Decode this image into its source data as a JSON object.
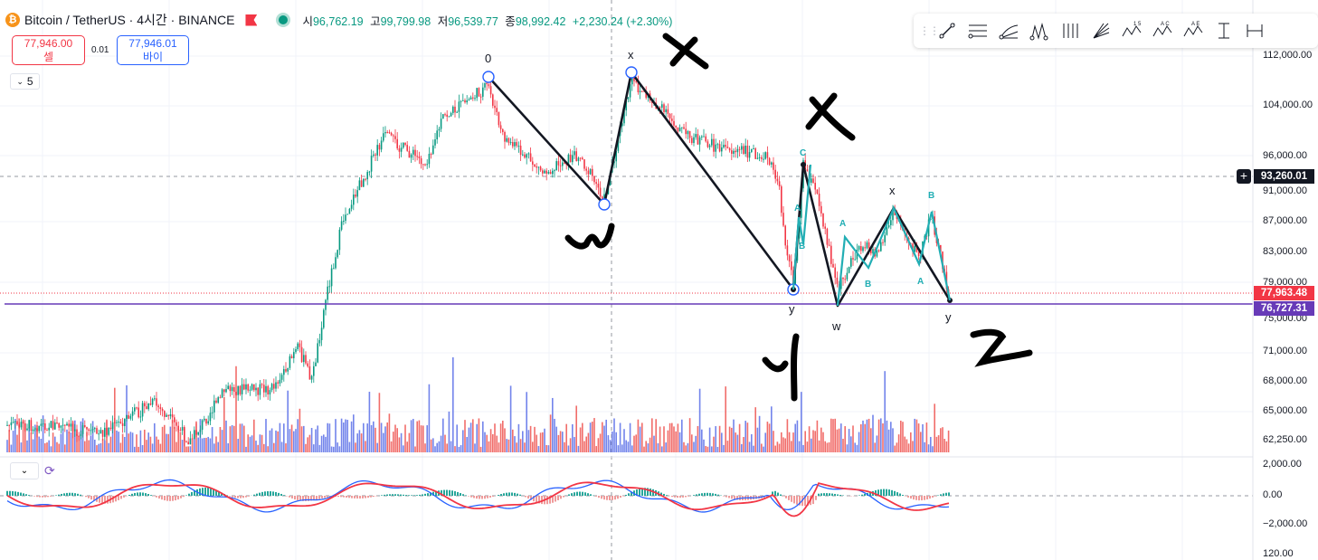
{
  "header": {
    "title": "Bitcoin / TetherUS · 4시간 · BINANCE",
    "ohlc": {
      "open_label": "시",
      "open": "96,762.19",
      "high_label": "고",
      "high": "99,799.98",
      "low_label": "저",
      "low": "96,539.77",
      "close_label": "종",
      "close": "98,992.42",
      "change": "+2,230.24 (+2.30%)"
    }
  },
  "trade": {
    "sell_price": "77,946.00",
    "sell_label": "셀",
    "spread": "0.01",
    "buy_price": "77,946.01",
    "buy_label": "바이"
  },
  "interval_control": "5",
  "toolbar_tools": [
    "trend-line",
    "parallel-channel",
    "pitchfork",
    "elliott-wave",
    "cycle-lines",
    "fib-fan",
    "xabcd-pattern",
    "abcd-pattern",
    "cypher-pattern",
    "bracket-tool",
    "date-range-tool"
  ],
  "price_axis": {
    "main": [
      "112,000.00",
      "104,000.00",
      "96,000.00",
      "91,000.00",
      "87,000.00",
      "83,000.00",
      "79,000.00",
      "75,000.00",
      "71,000.00",
      "68,000.00",
      "65,000.00",
      "62,250.00"
    ],
    "macd": [
      "2,000.00",
      "0.00",
      "−2,000.00",
      "120.00"
    ]
  },
  "price_tags": {
    "crosshair": "93,260.01",
    "last_price": "77,963.48",
    "horizontal_line": "76,727.31"
  },
  "colors": {
    "up": "#089981",
    "down": "#f23645",
    "volume_up": "#5b6ee8",
    "volume_down": "#ef5350",
    "wave_cyan": "#22aeb4",
    "horizontal_line": "#673ab7",
    "macd_line": "#2962ff",
    "signal_line": "#f23645"
  },
  "wave_labels": {
    "big_0": "0",
    "big_x": "x",
    "big_y": "y",
    "small_c": "C",
    "small_a1": "A",
    "small_b1": "B",
    "small_a2": "A",
    "small_b2": "B",
    "w_label": "w",
    "x_label": "x",
    "b_label": "B",
    "a_label": "A",
    "y_label": "y"
  },
  "chart_data": {
    "type": "candlestick",
    "symbol": "Bitcoin / TetherUS",
    "interval": "4시간",
    "exchange": "BINANCE",
    "price_levels": {
      "last": 77963.48,
      "horizontal_line": 76727.31,
      "crosshair": 93260.01
    },
    "wave_points": [
      {
        "label": "0",
        "price": 108000
      },
      {
        "label": "w",
        "price": 89500
      },
      {
        "label": "x",
        "price": 109000
      },
      {
        "label": "y",
        "price": 78000
      },
      {
        "label": "C",
        "price": 94500
      },
      {
        "label": "w",
        "price": 76000
      },
      {
        "label": "x",
        "price": 88500
      },
      {
        "label": "y",
        "price": 77000
      }
    ]
  }
}
